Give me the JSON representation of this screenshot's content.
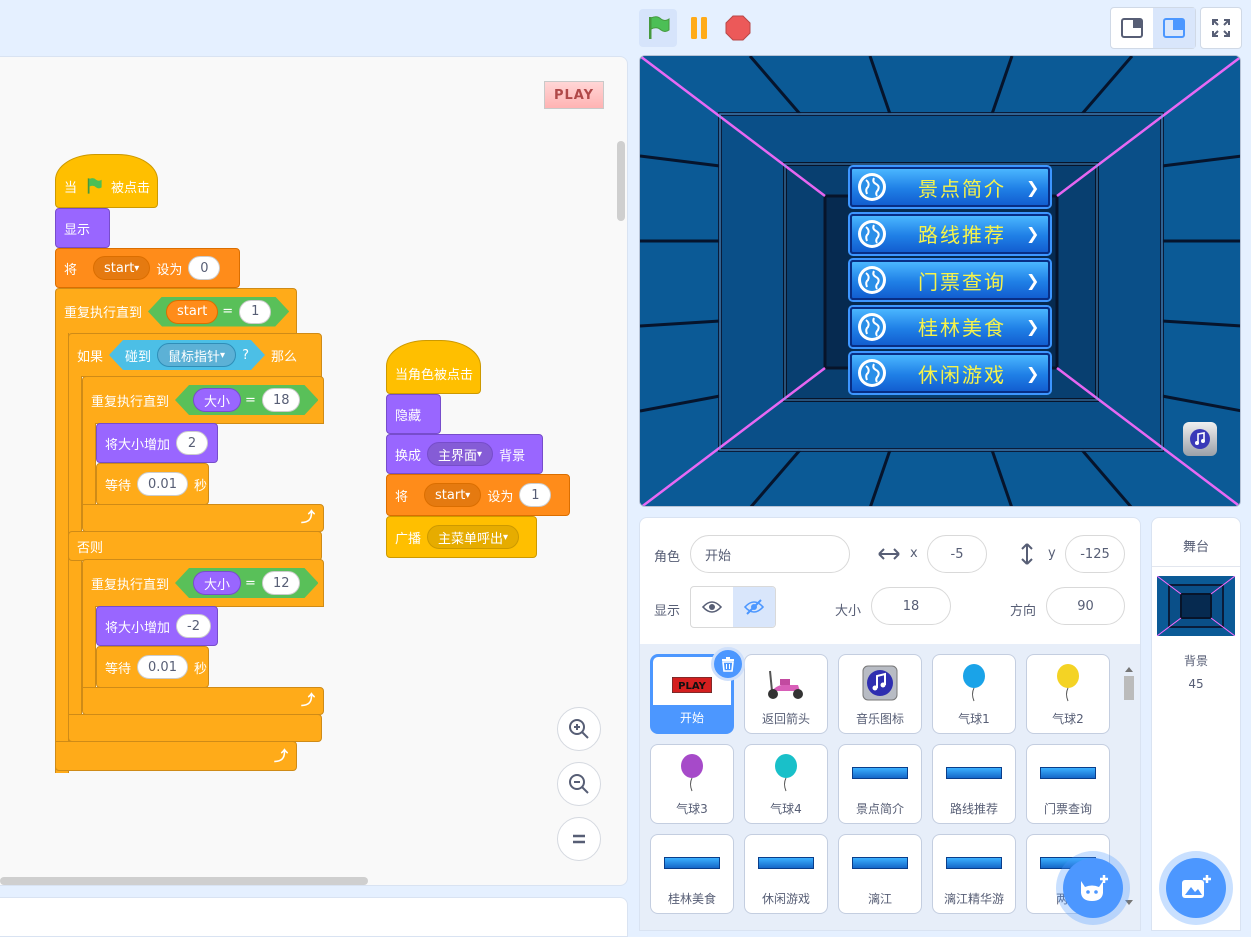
{
  "colors": {
    "accent": "#4c97ff",
    "events": "#ffbf00",
    "looks": "#9966ff",
    "variables": "#ff8c1a",
    "control": "#ffab19",
    "operators": "#59c059",
    "sensing": "#5cb1d6"
  },
  "code_area": {
    "play_sprite_label": "PLAY",
    "script1": {
      "hat": {
        "prefix": "当",
        "suffix": "被点击",
        "icon": "green-flag-icon"
      },
      "show": "显示",
      "set_var": {
        "prefix": "将",
        "var": "start",
        "mid": "设为",
        "value": "0"
      },
      "repeat_until": {
        "label": "重复执行直到",
        "var": "start",
        "op": "=",
        "value": "1"
      },
      "if": {
        "label": "如果",
        "touching": "碰到",
        "target": "鼠标指针",
        "q": "?",
        "then": "那么"
      },
      "inner_repeat1": {
        "label": "重复执行直到",
        "reporter": "大小",
        "op": "=",
        "value": "18"
      },
      "change_size1": {
        "label": "将大小增加",
        "value": "2"
      },
      "wait1": {
        "label": "等待",
        "value": "0.01",
        "unit": "秒"
      },
      "else": "否则",
      "inner_repeat2": {
        "label": "重复执行直到",
        "reporter": "大小",
        "op": "=",
        "value": "12"
      },
      "change_size2": {
        "label": "将大小增加",
        "value": "-2"
      },
      "wait2": {
        "label": "等待",
        "value": "0.01",
        "unit": "秒"
      }
    },
    "script2": {
      "hat": "当角色被点击",
      "hide": "隐藏",
      "switch_backdrop": {
        "prefix": "换成",
        "value": "主界面",
        "suffix": "背景"
      },
      "set_var": {
        "prefix": "将",
        "var": "start",
        "mid": "设为",
        "value": "1"
      },
      "broadcast": {
        "prefix": "广播",
        "value": "主菜单呼出"
      }
    }
  },
  "stage": {
    "menu_buttons": [
      "景点简介",
      "路线推荐",
      "门票查询",
      "桂林美食",
      "休闲游戏"
    ]
  },
  "sprite_info": {
    "sprite_label": "角色",
    "sprite_name": "开始",
    "x_label": "x",
    "x_value": "-5",
    "y_label": "y",
    "y_value": "-125",
    "show_label": "显示",
    "size_label": "大小",
    "size_value": "18",
    "direction_label": "方向",
    "direction_value": "90"
  },
  "sprites": [
    {
      "name": "开始",
      "thumb": "play",
      "selected": true
    },
    {
      "name": "返回箭头",
      "thumb": "scooter"
    },
    {
      "name": "音乐图标",
      "thumb": "music"
    },
    {
      "name": "气球1",
      "thumb": "balloon-blue"
    },
    {
      "name": "气球2",
      "thumb": "balloon-yellow"
    },
    {
      "name": "气球3",
      "thumb": "balloon-purple"
    },
    {
      "name": "气球4",
      "thumb": "balloon-teal"
    },
    {
      "name": "景点简介",
      "thumb": "mini"
    },
    {
      "name": "路线推荐",
      "thumb": "mini"
    },
    {
      "name": "门票查询",
      "thumb": "mini"
    },
    {
      "name": "桂林美食",
      "thumb": "mini"
    },
    {
      "name": "休闲游戏",
      "thumb": "mini"
    },
    {
      "name": "漓江",
      "thumb": "mini"
    },
    {
      "name": "漓江精华游",
      "thumb": "mini"
    },
    {
      "name": "两江",
      "thumb": "mini"
    }
  ],
  "stage_pane": {
    "title": "舞台",
    "backdrop_label": "背景",
    "backdrop_count": "45"
  }
}
